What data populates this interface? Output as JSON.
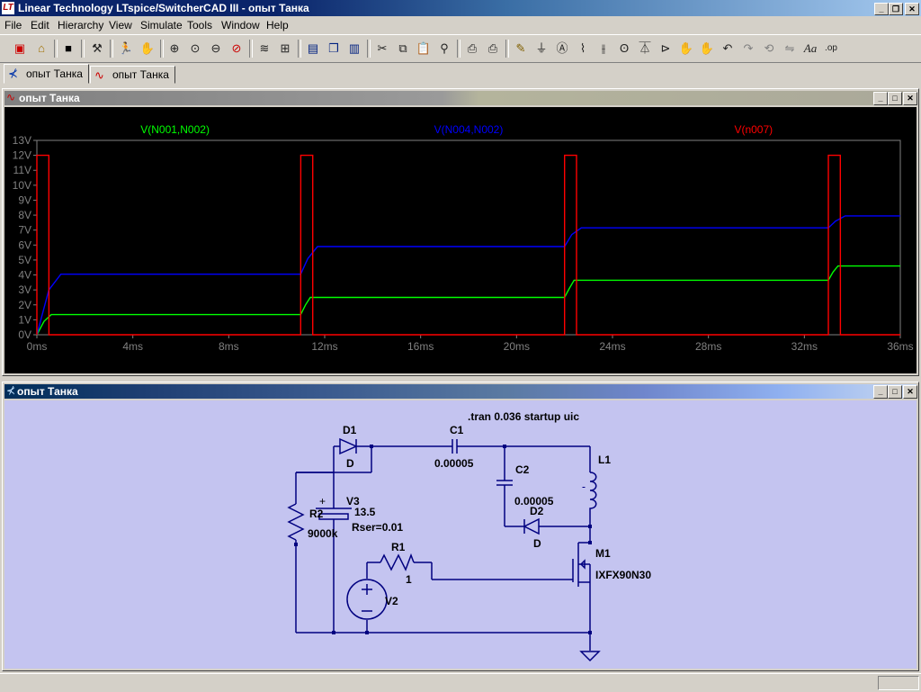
{
  "app": {
    "title": "Linear Technology LTspice/SwitcherCAD III - опыт Танка",
    "logo": "LT"
  },
  "window_controls": {
    "minimize": "_",
    "restore": "❐",
    "close": "✕"
  },
  "menu": [
    "File",
    "Edit",
    "Hierarchy",
    "View",
    "Simulate",
    "Tools",
    "Window",
    "Help"
  ],
  "toolbar_icons": [
    "open-schematic-icon",
    "open-file-icon",
    "save-icon",
    "control-panel-icon",
    "run-icon",
    "halt-icon",
    "zoom-in-icon",
    "zoom-pan-icon",
    "zoom-out-icon",
    "zoom-fit-icon",
    "autorange-icon",
    "grid-icon",
    "tile-horizontal-icon",
    "cascade-icon",
    "tile-vertical-icon",
    "cut-icon",
    "copy-icon",
    "paste-icon",
    "find-icon",
    "print-setup-icon",
    "print-icon",
    "wire-icon",
    "ground-icon",
    "label-icon",
    "resistor-icon",
    "capacitor-icon",
    "inductor-icon",
    "diode-icon",
    "component-icon",
    "move-icon",
    "drag-icon",
    "undo-icon",
    "redo-icon",
    "rotate-icon",
    "mirror-icon",
    "text-icon",
    "spice-directive-icon"
  ],
  "tabs": [
    {
      "label": "опыт Танка",
      "icon": "schematic-icon"
    },
    {
      "label": "опыт Танка",
      "icon": "waveform-icon"
    }
  ],
  "plot_window": {
    "title": "опыт Танка"
  },
  "schematic_window": {
    "title": "опыт Танка"
  },
  "chart_data": {
    "type": "line",
    "title": "",
    "xlabel": "",
    "ylabel": "",
    "xlim": [
      0,
      36
    ],
    "ylim": [
      0,
      13
    ],
    "x_ticks": [
      "0ms",
      "4ms",
      "8ms",
      "12ms",
      "16ms",
      "20ms",
      "24ms",
      "28ms",
      "32ms",
      "36ms"
    ],
    "y_ticks": [
      "0V",
      "1V",
      "2V",
      "3V",
      "4V",
      "5V",
      "6V",
      "7V",
      "8V",
      "9V",
      "10V",
      "11V",
      "12V",
      "13V"
    ],
    "x_units": "ms",
    "background": "#000000",
    "series": [
      {
        "name": "V(N001,N002)",
        "color": "#00ff00",
        "x": [
          0,
          0.3,
          0.6,
          11.0,
          11.2,
          11.4,
          22.0,
          22.2,
          22.4,
          33.0,
          33.2,
          33.4,
          36
        ],
        "y": [
          0,
          0.9,
          1.35,
          1.35,
          2.0,
          2.5,
          2.5,
          3.1,
          3.65,
          3.65,
          4.2,
          4.6,
          4.6
        ]
      },
      {
        "name": "V(N004,N002)",
        "color": "#0000ff",
        "x": [
          0,
          0.5,
          1.0,
          11.0,
          11.3,
          11.7,
          22.0,
          22.3,
          22.7,
          33.0,
          33.3,
          33.7,
          36
        ],
        "y": [
          0,
          3.0,
          4.05,
          4.05,
          5.1,
          5.9,
          5.9,
          6.7,
          7.15,
          7.15,
          7.6,
          7.95,
          7.95
        ]
      },
      {
        "name": "V(n007)",
        "color": "#ff0000",
        "x": [
          0,
          0.001,
          0.5,
          0.501,
          11.0,
          11.001,
          11.5,
          11.501,
          22.0,
          22.001,
          22.5,
          22.501,
          33.0,
          33.001,
          33.5,
          33.501,
          36
        ],
        "y": [
          0,
          12,
          12,
          0,
          0,
          12,
          12,
          0,
          0,
          12,
          12,
          0,
          0,
          12,
          12,
          0,
          0
        ]
      }
    ]
  },
  "schematic": {
    "directive": ".tran 0.036 startup uic",
    "components": [
      {
        "ref": "D1",
        "value": "D"
      },
      {
        "ref": "C1",
        "value": "0.00005"
      },
      {
        "ref": "C2",
        "value": "0.00005"
      },
      {
        "ref": "L1",
        "value": ""
      },
      {
        "ref": "D2",
        "value": "D"
      },
      {
        "ref": "R2",
        "value": "9000k"
      },
      {
        "ref": "V3",
        "value": "13.5",
        "extra": "Rser=0.01"
      },
      {
        "ref": "R1",
        "value": "1"
      },
      {
        "ref": "V2",
        "value": ""
      },
      {
        "ref": "M1",
        "value": "IXFX90N30"
      }
    ],
    "v3_plus": "+"
  }
}
